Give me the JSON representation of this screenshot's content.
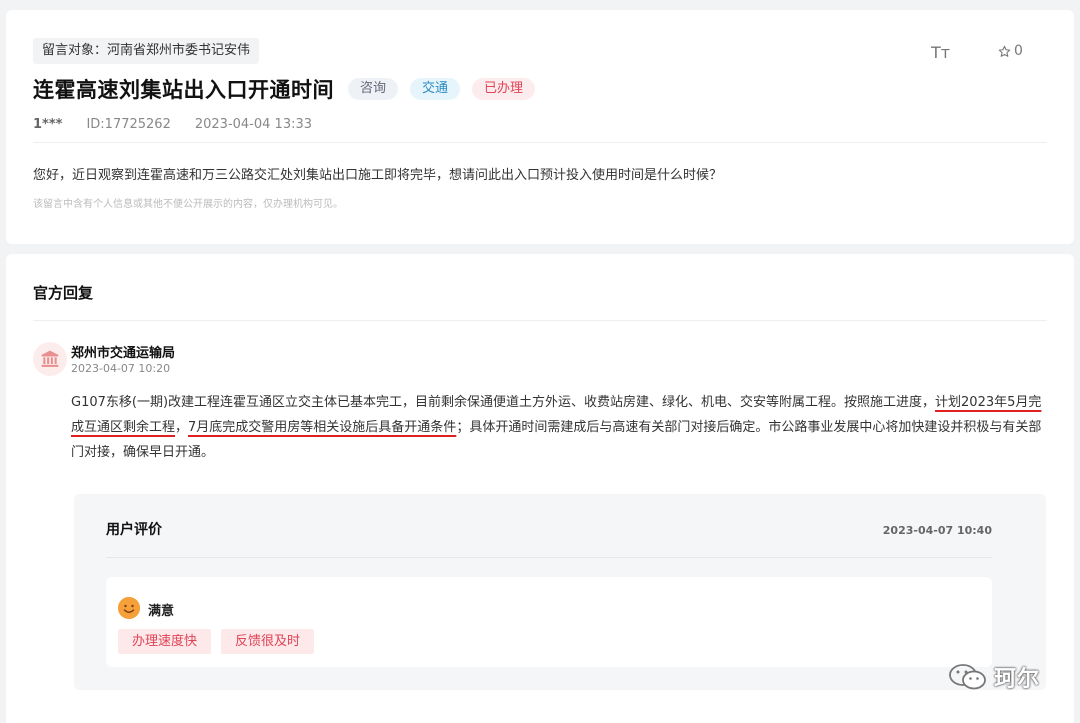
{
  "message": {
    "target": "留言对象：河南省郑州市委书记安伟",
    "title": "连霍高速刘集站出入口开通时间",
    "tags": [
      "咨询",
      "交通",
      "已办理"
    ],
    "font_toggle_label": "Tт",
    "star_count": "0",
    "author": "1***",
    "id": "ID:17725262",
    "date": "2023-04-04 13:33",
    "content": "您好，近日观察到连霍高速和万三公路交汇处刘集站出口施工即将完毕，想请问此出入口预计投入使用时间是什么时候？",
    "notice": "该留言中含有个人信息或其他不便公开展示的内容，仅办理机构可见。"
  },
  "reply": {
    "section_title": "官方回复",
    "org": "郑州市交通运输局",
    "time": "2023-04-07 10:20",
    "text_part1": "G107东移(一期)改建工程连霍互通区立交主体已基本完工，目前剩余保通便道土方外运、收费站房建、绿化、机电、交安等附属工程。按照施工进度，",
    "text_underline1": "计划2023年5月完成互通区剩余工程",
    "text_part2": "，",
    "text_underline2": "7月底完成交警用房等相关设施后具备开通条件",
    "text_part3": "；具体开通时间需建成后与高速有关部门对接后确定。市公路事业发展中心将加快建设并积极与有关部门对接，确保早日开通。"
  },
  "evaluation": {
    "title": "用户评价",
    "time": "2023-04-07 10:40",
    "satisfaction": "满意",
    "chips": [
      "办理速度快",
      "反馈很及时"
    ]
  },
  "watermark": {
    "text": "珂尔"
  },
  "colors": {
    "accent_red": "#e04456",
    "underline_red": "#e02020",
    "tag_blue": "#2c8ac2"
  }
}
